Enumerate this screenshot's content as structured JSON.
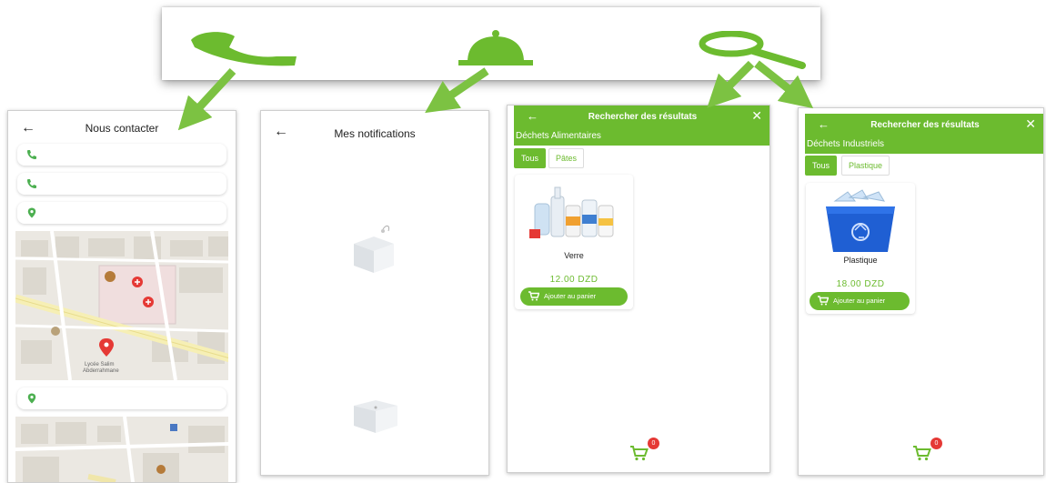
{
  "colors": {
    "accent": "#6cbb2f",
    "badge": "#e53935",
    "map_marker": "#e53935"
  },
  "icons": {
    "top_bar": [
      "phone-icon",
      "bell-icon",
      "search-icon"
    ],
    "contact_rows": [
      "phone-icon",
      "phone-icon",
      "location-pin-icon",
      "location-pin-icon"
    ]
  },
  "contact": {
    "back": "←",
    "title": "Nous contacter",
    "map_label_line1": "Lycée Salim",
    "map_label_line2": "Abderrahmane"
  },
  "notifications": {
    "back": "←",
    "title": "Mes notifications"
  },
  "search_food": {
    "back": "←",
    "title": "Rechercher des résultats",
    "close": "✕",
    "category": "Déchets Alimentaires",
    "chips": [
      "Tous",
      "Pâtes"
    ],
    "product": {
      "name": "Verre",
      "price": "12.00 DZD",
      "button": "Ajouter au panier"
    },
    "cart_count": "0"
  },
  "search_industrial": {
    "back": "←",
    "title": "Rechercher des résultats",
    "close": "✕",
    "category": "Déchets Industriels",
    "chips": [
      "Tous",
      "Plastique"
    ],
    "product": {
      "name": "Plastique",
      "price": "18.00 DZD",
      "button": "Ajouter au panier"
    },
    "cart_count": "0"
  }
}
